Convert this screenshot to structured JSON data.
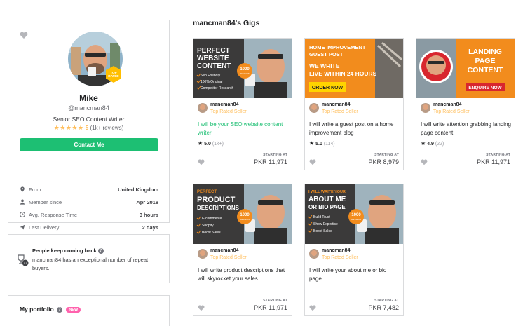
{
  "profile": {
    "name": "Mike",
    "handle": "@mancman84",
    "title": "Senior SEO Content Writer",
    "badge": "TOP RATED",
    "stars": "★★★★★",
    "rating": "5",
    "reviews": "(1k+ reviews)",
    "contact_label": "Contact Me",
    "stats": [
      {
        "label": "From",
        "value": "United Kingdom",
        "icon": "location-pin-icon"
      },
      {
        "label": "Member since",
        "value": "Apr 2018",
        "icon": "user-icon"
      },
      {
        "label": "Avg. Response Time",
        "value": "3 hours",
        "icon": "clock-icon"
      },
      {
        "label": "Last Delivery",
        "value": "2 days",
        "icon": "paper-plane-icon"
      }
    ]
  },
  "notice": {
    "title": "People keep coming back",
    "help": "?",
    "body": "mancman84 has an exceptional number of repeat buyers."
  },
  "portfolio": {
    "title": "My portfolio",
    "help": "?",
    "badge": "NEW"
  },
  "gigs_title": "mancman84's Gigs",
  "gigs": [
    {
      "thumb_lines": [
        "PERFECT",
        "WEBSITE",
        "CONTENT"
      ],
      "thumb_bullets": [
        "Seo Friendly",
        "100% Original",
        "Competitor Research"
      ],
      "thumb_badge": "1000",
      "thumb_badge_sub": "REVIEWS",
      "seller": "mancman84",
      "level": "Top Rated Seller",
      "title": "I will be your SEO website content writer",
      "rating": "5.0",
      "count": "(1k+)",
      "starting": "STARTING AT",
      "price": "PKR 11,971"
    },
    {
      "thumb_lines": [
        "HOME IMPROVEMENT",
        "GUEST POST",
        "WE WRITE",
        "LIVE WITHIN 24 HOURS"
      ],
      "thumb_cta": "ORDER NOW",
      "seller": "mancman84",
      "level": "Top Rated Seller",
      "title": "I will write a guest post on a home improvement blog",
      "rating": "5.0",
      "count": "(114)",
      "starting": "STARTING AT",
      "price": "PKR 8,979"
    },
    {
      "thumb_lines": [
        "LANDING",
        "PAGE",
        "CONTENT"
      ],
      "thumb_cta": "ENQUIRE NOW",
      "seller": "mancman84",
      "level": "Top Rated Seller",
      "title": "I will write attention grabbing landing page content",
      "rating": "4.9",
      "count": "(22)",
      "starting": "STARTING AT",
      "price": "PKR 11,971"
    },
    {
      "thumb_lines": [
        "PERFECT",
        "PRODUCT",
        "DESCRIPTIONS"
      ],
      "thumb_bullets": [
        "E-commerce",
        "Shopify",
        "Boost Sales"
      ],
      "thumb_badge": "1000",
      "thumb_badge_sub": "REVIEWS",
      "seller": "mancman84",
      "level": "Top Rated Seller",
      "title": "I will write product descriptions that will skyrocket your sales",
      "starting": "STARTING AT",
      "price": "PKR 11,971"
    },
    {
      "thumb_lines": [
        "I WILL WRITE YOUR",
        "ABOUT ME",
        "OR BIO PAGE"
      ],
      "thumb_bullets": [
        "Build Trust",
        "Show Expertise",
        "Boost Sales"
      ],
      "thumb_badge": "1000",
      "thumb_badge_sub": "REVIEWS",
      "seller": "mancman84",
      "level": "Top Rated Seller",
      "title": "I will write your about me or bio page",
      "starting": "STARTING AT",
      "price": "PKR 7,482"
    }
  ],
  "colors": {
    "green": "#1dbf73",
    "gold": "#ffbe5b",
    "thumb_dark": "#3b3a3a",
    "thumb_orange": "#f28c1d",
    "thumb_red": "#d8262e",
    "new_badge": "#ff62ad"
  }
}
